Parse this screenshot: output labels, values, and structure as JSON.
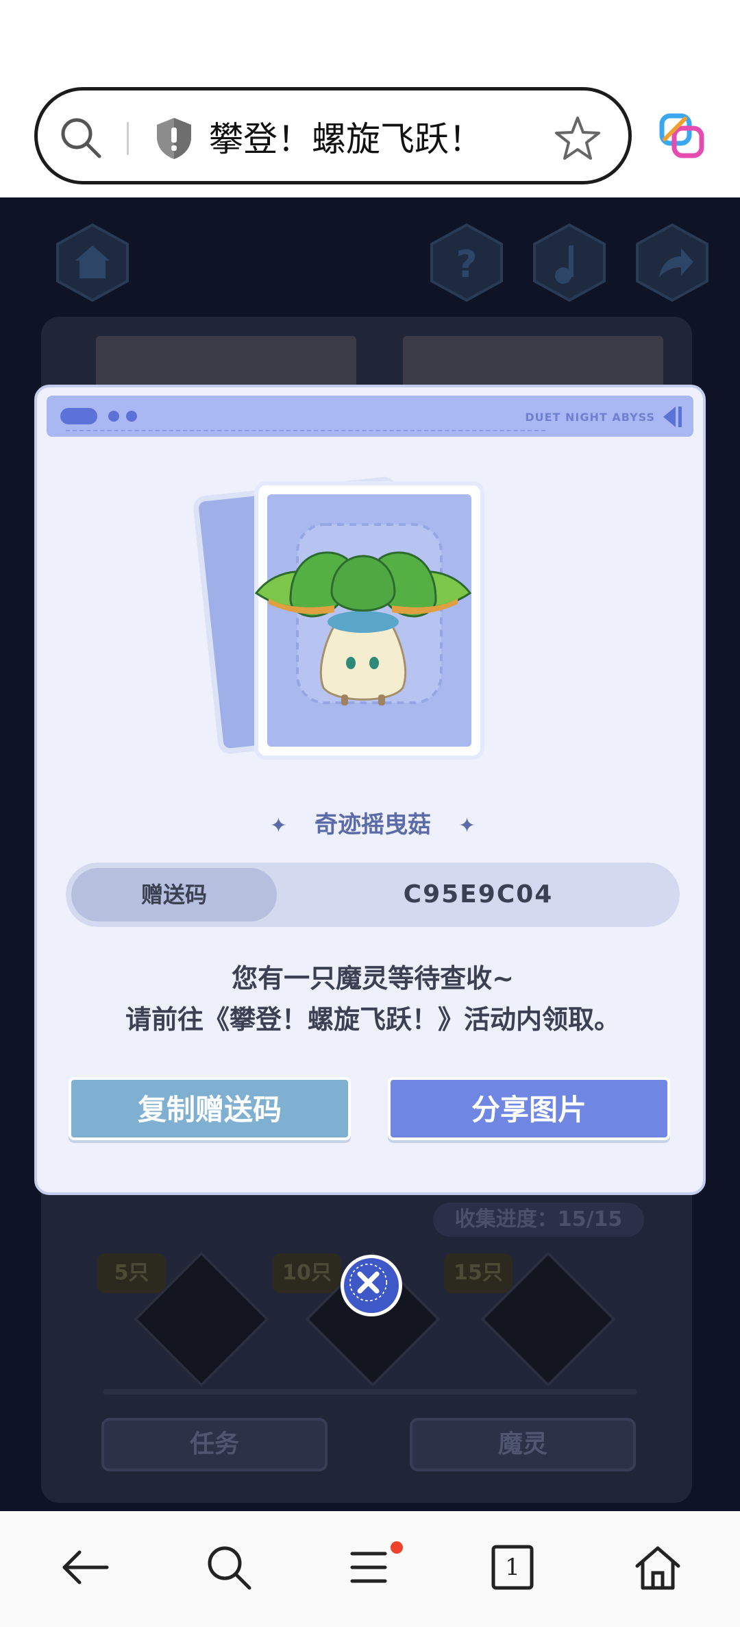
{
  "browser": {
    "url_title": "攀登！螺旋飞跃！",
    "icons": [
      "search-icon",
      "shield-icon",
      "star-icon",
      "app-logo-icon"
    ]
  },
  "game_background": {
    "top_icons": [
      "home-icon",
      "help-icon",
      "music-icon",
      "share-icon"
    ],
    "progress_text": "收集进度：15/15",
    "reward_tags": [
      "5只",
      "10只",
      "15只"
    ],
    "tabs": [
      "任务",
      "魔灵"
    ]
  },
  "modal": {
    "header_brand": "DUET NIGHT ABYSS",
    "item_name": "奇迹摇曳菇",
    "code_label": "赠送码",
    "code_value": "C95E9C04",
    "message_line1": "您有一只魔灵等待查收~",
    "message_line2": "请前往《攀登！螺旋飞跃！》活动内领取。",
    "copy_button": "复制赠送码",
    "share_button": "分享图片"
  },
  "bottom_nav": {
    "items": [
      "back-icon",
      "search-icon",
      "menu-icon",
      "tabs-icon",
      "home-icon"
    ],
    "tab_count": "1"
  }
}
